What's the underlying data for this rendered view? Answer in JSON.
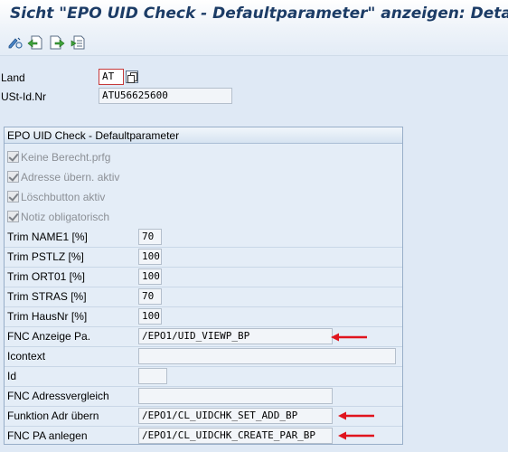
{
  "window": {
    "title": "Sicht \"EPO UID Check - Defaultparameter\" anzeigen: Detail"
  },
  "toolbar": {
    "icons": [
      "display-change-icon",
      "previous-entry-icon",
      "next-entry-icon",
      "select-entry-icon"
    ]
  },
  "header": {
    "land_label": "Land",
    "land_value": "AT",
    "ust_label": "USt-Id.Nr",
    "ust_value": "ATU56625600"
  },
  "group": {
    "title": "EPO UID Check - Defaultparameter",
    "checkboxes": [
      {
        "label": "Keine Berecht.prfg",
        "checked": true
      },
      {
        "label": "Adresse übern. aktiv",
        "checked": true
      },
      {
        "label": "Löschbutton aktiv",
        "checked": true
      },
      {
        "label": "Notiz obligatorisch",
        "checked": true
      }
    ],
    "fields": [
      {
        "label": "Trim NAME1 [%]",
        "value": "70"
      },
      {
        "label": "Trim PSTLZ [%]",
        "value": "100"
      },
      {
        "label": "Trim ORT01 [%]",
        "value": "100"
      },
      {
        "label": "Trim STRAS [%]",
        "value": "70"
      },
      {
        "label": "Trim HausNr [%]",
        "value": "100"
      },
      {
        "label": "FNC Anzeige Pa.",
        "value": "/EPO1/UID_VIEWP_BP"
      },
      {
        "label": "Icontext",
        "value": ""
      },
      {
        "label": "Id",
        "value": ""
      },
      {
        "label": "FNC Adressvergleich",
        "value": ""
      },
      {
        "label": "Funktion Adr übern",
        "value": "/EPO1/CL_UIDCHK_SET_ADD_BP"
      },
      {
        "label": "FNC PA anlegen",
        "value": "/EPO1/CL_UIDCHK_CREATE_PAR_BP"
      }
    ]
  },
  "colors": {
    "annotation_arrow": "#e0141e",
    "title_text": "#1c3c66",
    "background": "#dfe9f5"
  }
}
